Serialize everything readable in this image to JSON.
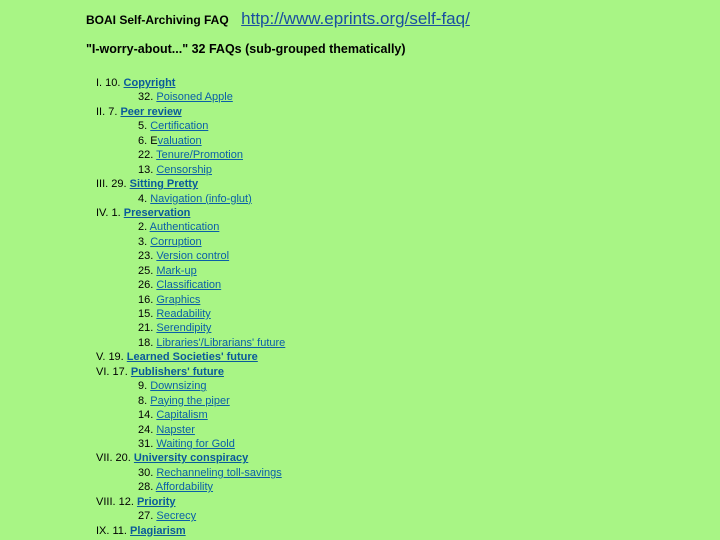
{
  "header": {
    "title": "BOAI Self-Archiving FAQ",
    "url": "http://www.eprints.org/self-faq/"
  },
  "subtitle": "\"I-worry-about...\" 32 FAQs (sub-grouped thematically)",
  "colors": {
    "background": "#a8f585",
    "link": "#0a5fa8"
  },
  "items": [
    {
      "prefix": "I. 10. ",
      "label": "Copyright",
      "major": true
    },
    {
      "prefix": "32. ",
      "label": "Poisoned Apple",
      "major": false
    },
    {
      "prefix": "II. 7. ",
      "label": "Peer review",
      "major": true
    },
    {
      "prefix": "5. ",
      "label": "Certification",
      "major": false
    },
    {
      "prefix": "6. E",
      "label": "valuation",
      "major": false
    },
    {
      "prefix": "22. ",
      "label": "Tenure/Promotion",
      "major": false
    },
    {
      "prefix": "13. ",
      "label": "Censorship",
      "major": false
    },
    {
      "prefix": "III. 29. ",
      "label": "Sitting Pretty",
      "major": true
    },
    {
      "prefix": "4. ",
      "label": "Navigation (info-glut)",
      "major": false
    },
    {
      "prefix": "IV. 1. ",
      "label": "Preservation",
      "major": true
    },
    {
      "prefix": "2. ",
      "label": "Authentication",
      "major": false
    },
    {
      "prefix": "3. ",
      "label": "Corruption",
      "major": false
    },
    {
      "prefix": "23. ",
      "label": "Version control",
      "major": false
    },
    {
      "prefix": "25. ",
      "label": "Mark-up",
      "major": false
    },
    {
      "prefix": "26. ",
      "label": "Classification",
      "major": false
    },
    {
      "prefix": "16. ",
      "label": "Graphics",
      "major": false
    },
    {
      "prefix": "15. ",
      "label": "Readability",
      "major": false
    },
    {
      "prefix": "21. ",
      "label": "Serendipity",
      "major": false
    },
    {
      "prefix": "18. ",
      "label": "Libraries'/Librarians' future",
      "major": false
    },
    {
      "prefix": "V. 19. ",
      "label": "Learned Societies' future",
      "major": true
    },
    {
      "prefix": "VI. 17. ",
      "label": "Publishers' future",
      "major": true
    },
    {
      "prefix": "9. ",
      "label": "Downsizing",
      "major": false
    },
    {
      "prefix": "8. ",
      "label": "Paying the piper",
      "major": false
    },
    {
      "prefix": "14. ",
      "label": "Capitalism",
      "major": false
    },
    {
      "prefix": "24. ",
      "label": "Napster",
      "major": false
    },
    {
      "prefix": "31. ",
      "label": "Waiting for Gold",
      "major": false
    },
    {
      "prefix": "VII. 20. ",
      "label": "University conspiracy",
      "major": true
    },
    {
      "prefix": "30. ",
      "label": "Rechanneling toll-savings",
      "major": false
    },
    {
      "prefix": "28. ",
      "label": "Affordability",
      "major": false
    },
    {
      "prefix": "VIII. 12. ",
      "label": "Priority",
      "major": true
    },
    {
      "prefix": "27. ",
      "label": "Secrecy",
      "major": false
    },
    {
      "prefix": "IX. 11. ",
      "label": "Plagiarism",
      "major": true
    }
  ]
}
